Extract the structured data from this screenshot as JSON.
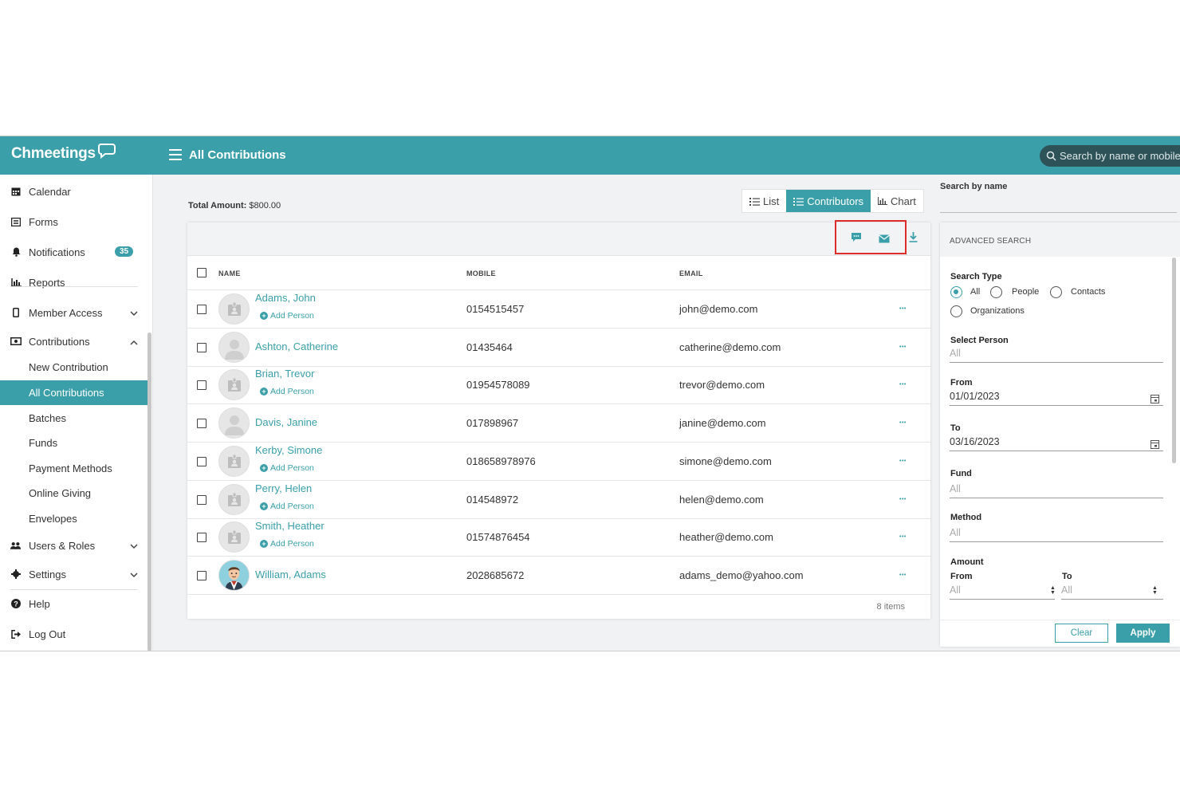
{
  "header": {
    "logo": "Chmeetings",
    "title": "All Contributions",
    "search_placeholder": "Search by name or mobile"
  },
  "sidebar": {
    "items": [
      {
        "label": "Calendar",
        "icon": "calendar-icon"
      },
      {
        "label": "Forms",
        "icon": "forms-icon"
      },
      {
        "label": "Notifications",
        "icon": "bell-icon",
        "badge": "35"
      },
      {
        "label": "Reports",
        "icon": "bar-chart-icon"
      },
      {
        "label": "Member Access",
        "icon": "mobile-icon"
      },
      {
        "label": "Contributions",
        "icon": "money-icon"
      }
    ],
    "contributions_sub": [
      "New Contribution",
      "All Contributions",
      "Batches",
      "Funds",
      "Payment Methods",
      "Online Giving",
      "Envelopes"
    ],
    "bottom_items": [
      {
        "label": "Users & Roles",
        "icon": "users-icon"
      },
      {
        "label": "Settings",
        "icon": "gear-icon"
      },
      {
        "label": "Help",
        "icon": "help-icon"
      },
      {
        "label": "Log Out",
        "icon": "logout-icon"
      }
    ]
  },
  "summary": {
    "total_label": "Total Amount:",
    "total_value": "$800.00"
  },
  "view_switch": {
    "list": "List",
    "contributors": "Contributors",
    "chart": "Chart",
    "active": "Contributors"
  },
  "table": {
    "columns": [
      "NAME",
      "MOBILE",
      "EMAIL"
    ],
    "add_person_label": "Add Person",
    "rows": [
      {
        "name": "Adams, John",
        "mobile": "0154515457",
        "email": "john@demo.com",
        "add_person": true,
        "avatar": "contact"
      },
      {
        "name": "Ashton, Catherine",
        "mobile": "01435464",
        "email": "catherine@demo.com",
        "add_person": false,
        "avatar": "person"
      },
      {
        "name": "Brian, Trevor",
        "mobile": "01954578089",
        "email": "trevor@demo.com",
        "add_person": true,
        "avatar": "contact"
      },
      {
        "name": "Davis, Janine",
        "mobile": "017898967",
        "email": "janine@demo.com",
        "add_person": false,
        "avatar": "person"
      },
      {
        "name": "Kerby, Simone",
        "mobile": "018658978976",
        "email": "simone@demo.com",
        "add_person": true,
        "avatar": "contact"
      },
      {
        "name": "Perry, Helen",
        "mobile": "014548972",
        "email": "helen@demo.com",
        "add_person": true,
        "avatar": "contact"
      },
      {
        "name": "Smith, Heather",
        "mobile": "01574876454",
        "email": "heather@demo.com",
        "add_person": true,
        "avatar": "contact"
      },
      {
        "name": "William, Adams",
        "mobile": "2028685672",
        "email": "adams_demo@yahoo.com",
        "add_person": false,
        "avatar": "photo"
      }
    ],
    "items_count": "8 items"
  },
  "search_panel": {
    "search_by_name_label": "Search by name",
    "advanced_title": "ADVANCED SEARCH",
    "search_type_label": "Search Type",
    "search_type_options": [
      "All",
      "People",
      "Contacts",
      "Organizations"
    ],
    "search_type_selected": "All",
    "select_person_label": "Select Person",
    "select_person_value": "All",
    "from_label": "From",
    "from_value": "01/01/2023",
    "to_label": "To",
    "to_value": "03/16/2023",
    "fund_label": "Fund",
    "fund_value": "All",
    "method_label": "Method",
    "method_value": "All",
    "amount_label": "Amount",
    "amount_from_label": "From",
    "amount_from_value": "All",
    "amount_to_label": "To",
    "amount_to_value": "All",
    "clear_label": "Clear",
    "apply_label": "Apply"
  },
  "colors": {
    "accent": "#3a9fa8",
    "highlight": "#e02b2b"
  }
}
